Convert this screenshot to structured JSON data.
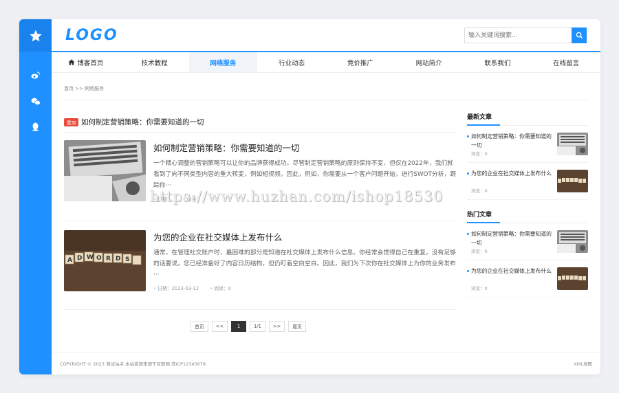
{
  "header": {
    "logo": "LOGO",
    "search_placeholder": "输入关键词搜索..."
  },
  "nav": {
    "items": [
      {
        "label": "博客首页",
        "icon": "home-icon"
      },
      {
        "label": "技术教程"
      },
      {
        "label": "网络服务",
        "active": true
      },
      {
        "label": "行业动态"
      },
      {
        "label": "竞价推广"
      },
      {
        "label": "网站简介"
      },
      {
        "label": "联系我们"
      },
      {
        "label": "在线留言"
      }
    ]
  },
  "breadcrumb": "首页 >> 网络服务",
  "top_post": {
    "badge": "置顶",
    "title": "如何制定营销策略：你需要知道的一切"
  },
  "posts": [
    {
      "title": "如何制定营销策略：你需要知道的一切",
      "desc": "一个精心调整的营销策略可以让你的品牌获得成功。尽管制定营销策略的原则保持不变，但仅在2022年，我们就看到了向不同类型内容的重大转变，例如短视频。因此，例如，你需要从一个客户问题开始，进行SWOT分析，跟踪你···",
      "date": "日期：",
      "views": "阅读："
    },
    {
      "title": "为您的企业在社交媒体上发布什么",
      "desc": "通常，在管理社交账户时，最困难的部分是知道在社交媒体上发布什么信息。你经常会觉得自己在重复，没有足够的话要说。您已经准备好了内容日历结构，但仍盯着空白空白。因此，我们为下次你在社交媒体上为你的业务发布···",
      "date": "日期：2023-03-12",
      "views": "阅读：0"
    }
  ],
  "pager": [
    "首页",
    "<<",
    "1",
    "1/1",
    ">>",
    "尾页"
  ],
  "aside": {
    "latest_title": "最新文章",
    "hot_title": "热门文章",
    "latest": [
      {
        "title": "如何制定营销策略：你需要知道的一切",
        "views": "浏览：0"
      },
      {
        "title": "为您的企业在社交媒体上发布什么",
        "views": "浏览：0"
      }
    ],
    "hot": [
      {
        "title": "如何制定营销策略：你需要知道的一切",
        "views": "浏览：0"
      },
      {
        "title": "为您的企业在社交媒体上发布什么",
        "views": "浏览：0"
      }
    ]
  },
  "footer": {
    "copyright": "COPYRIGHT © 2023 测试站点 本站资源来源于互联网 苏ICP12345678",
    "sitemap": "XML地图"
  },
  "watermark": "https://www.huzhan.com/ishop18530",
  "colors": {
    "accent": "#1e90ff",
    "badge": "#e74c3c"
  }
}
